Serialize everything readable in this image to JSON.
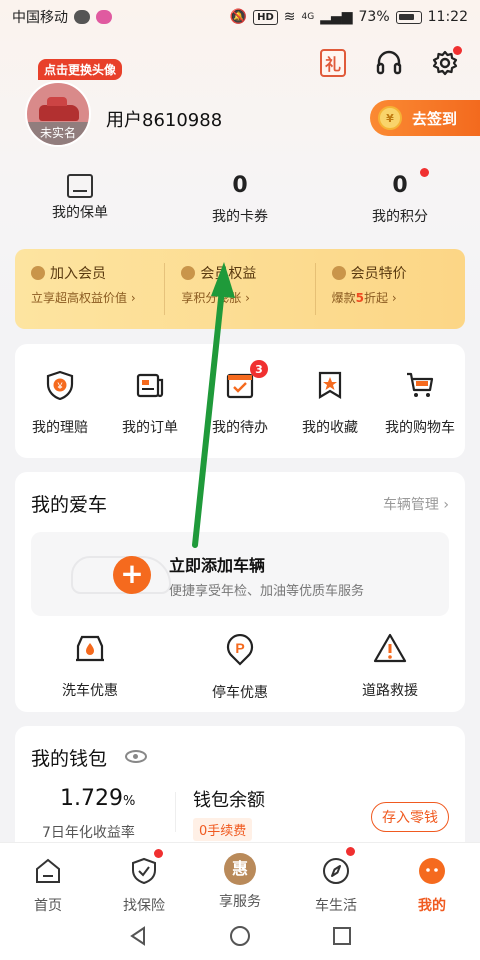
{
  "status_bar": {
    "carrier": "中国移动",
    "battery": "73%",
    "time": "11:22",
    "signal_label": "4G",
    "hd_label": "HD"
  },
  "header": {
    "avatar_tag": "点击更换头像",
    "avatar_label": "未实名",
    "username": "用户8610988",
    "signin_label": "去签到",
    "coin_label": "¥",
    "gift_label": "礼"
  },
  "stats": [
    {
      "value": "",
      "label": "我的保单"
    },
    {
      "value": "0",
      "label": "我的卡券"
    },
    {
      "value": "0",
      "label": "我的积分"
    }
  ],
  "member": [
    {
      "title": "加入会员",
      "sub": "立享超高权益价值 ›"
    },
    {
      "title": "会员权益",
      "sub": "享积分膨胀 ›"
    },
    {
      "title": "会员特价",
      "sub_pre": "爆款",
      "sub_hl": "5",
      "sub_post": "折起 ›"
    }
  ],
  "quick_actions": [
    {
      "label": "我的理赔",
      "icon": "shield-yen-icon"
    },
    {
      "label": "我的订单",
      "icon": "order-icon"
    },
    {
      "label": "我的待办",
      "icon": "todo-icon",
      "badge": "3"
    },
    {
      "label": "我的收藏",
      "icon": "star-bookmark-icon"
    },
    {
      "label": "我的购物车",
      "icon": "cart-icon"
    }
  ],
  "my_car": {
    "title": "我的爱车",
    "manage": "车辆管理 ›",
    "add_title": "立即添加车辆",
    "add_sub": "便捷享受年检、加油等优质车服务",
    "plus": "+",
    "services": [
      {
        "label": "洗车优惠",
        "icon": "car-wash-icon"
      },
      {
        "label": "停车优惠",
        "icon": "parking-icon"
      },
      {
        "label": "道路救援",
        "icon": "warning-icon"
      }
    ]
  },
  "wallet": {
    "title": "我的钱包",
    "rate_value": "1.729",
    "rate_unit": "%",
    "rate_label": "7日年化收益率",
    "balance_label": "钱包余额",
    "fee_label": "0手续费",
    "deposit_label": "存入零钱"
  },
  "tabs": [
    {
      "label": "首页",
      "icon": "home-icon"
    },
    {
      "label": "找保险",
      "icon": "shield-check-icon"
    },
    {
      "label": "享服务",
      "icon": "service-icon",
      "center": "惠"
    },
    {
      "label": "车生活",
      "icon": "compass-icon"
    },
    {
      "label": "我的",
      "icon": "profile-icon"
    }
  ],
  "colors": {
    "accent": "#f05a20",
    "member_bg": "#fcd686",
    "arrow": "#1f9a3a"
  }
}
